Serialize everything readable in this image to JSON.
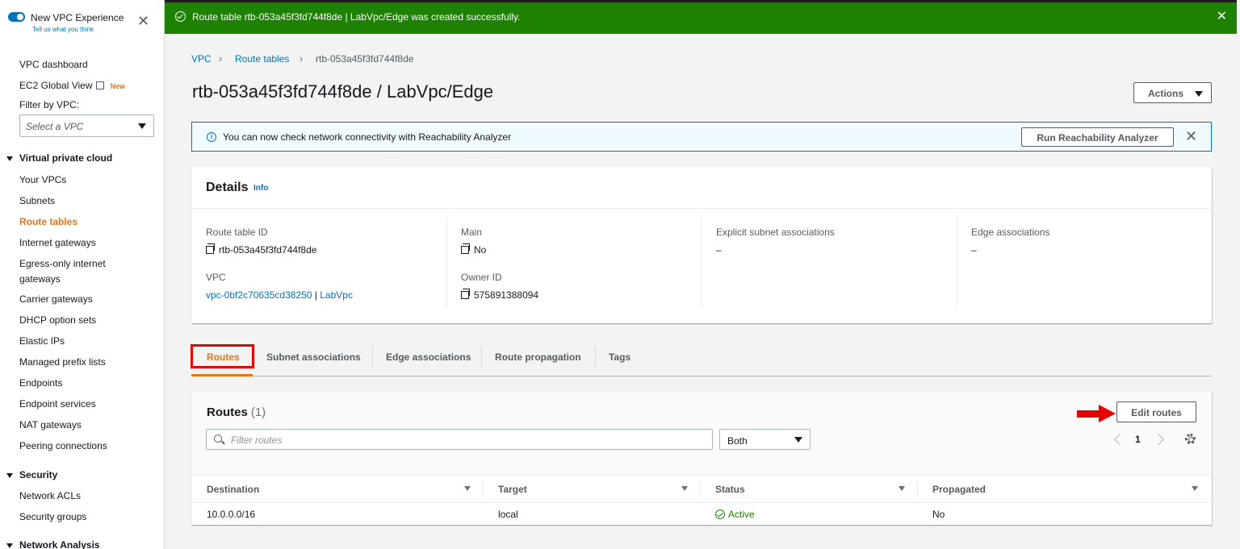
{
  "sidebar": {
    "experience_title": "New VPC Experience",
    "experience_sub": "Tell us what you think",
    "vpc_dashboard": "VPC dashboard",
    "ec2_global_view": "EC2 Global View",
    "new_badge": "New",
    "filter_label": "Filter by VPC:",
    "vpc_select_placeholder": "Select a VPC",
    "section_vpc": "Virtual private cloud",
    "items": [
      "Your VPCs",
      "Subnets",
      "Route tables",
      "Internet gateways",
      "Egress-only internet",
      "gateways",
      "Carrier gateways",
      "DHCP option sets",
      "Elastic IPs",
      "Managed prefix lists",
      "Endpoints",
      "Endpoint services",
      "NAT gateways",
      "Peering connections"
    ],
    "active_item": "Route tables",
    "section_security": "Security",
    "security_items": [
      "Network ACLs",
      "Security groups"
    ],
    "section_network_analysis": "Network Analysis"
  },
  "flash": {
    "message": "Route table rtb-053a45f3fd744f8de | LabVpc/Edge was created successfully."
  },
  "breadcrumb": {
    "vpc": "VPC",
    "route_tables": "Route tables",
    "current": "rtb-053a45f3fd744f8de"
  },
  "page_title": "rtb-053a45f3fd744f8de / LabVpc/Edge",
  "actions_label": "Actions",
  "info_bar": {
    "message": "You can now check network connectivity with Reachability Analyzer",
    "button": "Run Reachability Analyzer"
  },
  "details": {
    "title": "Details",
    "info": "Info",
    "route_table_id_label": "Route table ID",
    "route_table_id": "rtb-053a45f3fd744f8de",
    "vpc_label": "VPC",
    "vpc_id": "vpc-0bf2c70635cd38250",
    "vpc_sep": "|",
    "vpc_name": "LabVpc",
    "main_label": "Main",
    "main_value": "No",
    "owner_label": "Owner ID",
    "owner_value": "575891388094",
    "explicit_label": "Explicit subnet associations",
    "explicit_value": "–",
    "edge_label": "Edge associations",
    "edge_value": "–"
  },
  "tabs": [
    "Routes",
    "Subnet associations",
    "Edge associations",
    "Route propagation",
    "Tags"
  ],
  "routes": {
    "title": "Routes",
    "count": "(1)",
    "edit_button": "Edit routes",
    "filter_placeholder": "Filter routes",
    "select_value": "Both",
    "page": "1",
    "columns": [
      "Destination",
      "Target",
      "Status",
      "Propagated"
    ],
    "rows": [
      {
        "destination": "10.0.0.0/16",
        "target": "local",
        "status": "Active",
        "propagated": "No"
      }
    ]
  },
  "colors": {
    "success": "#1d8102",
    "accent": "#ec7211",
    "link": "#0073bb",
    "highlight": "#e60000"
  }
}
